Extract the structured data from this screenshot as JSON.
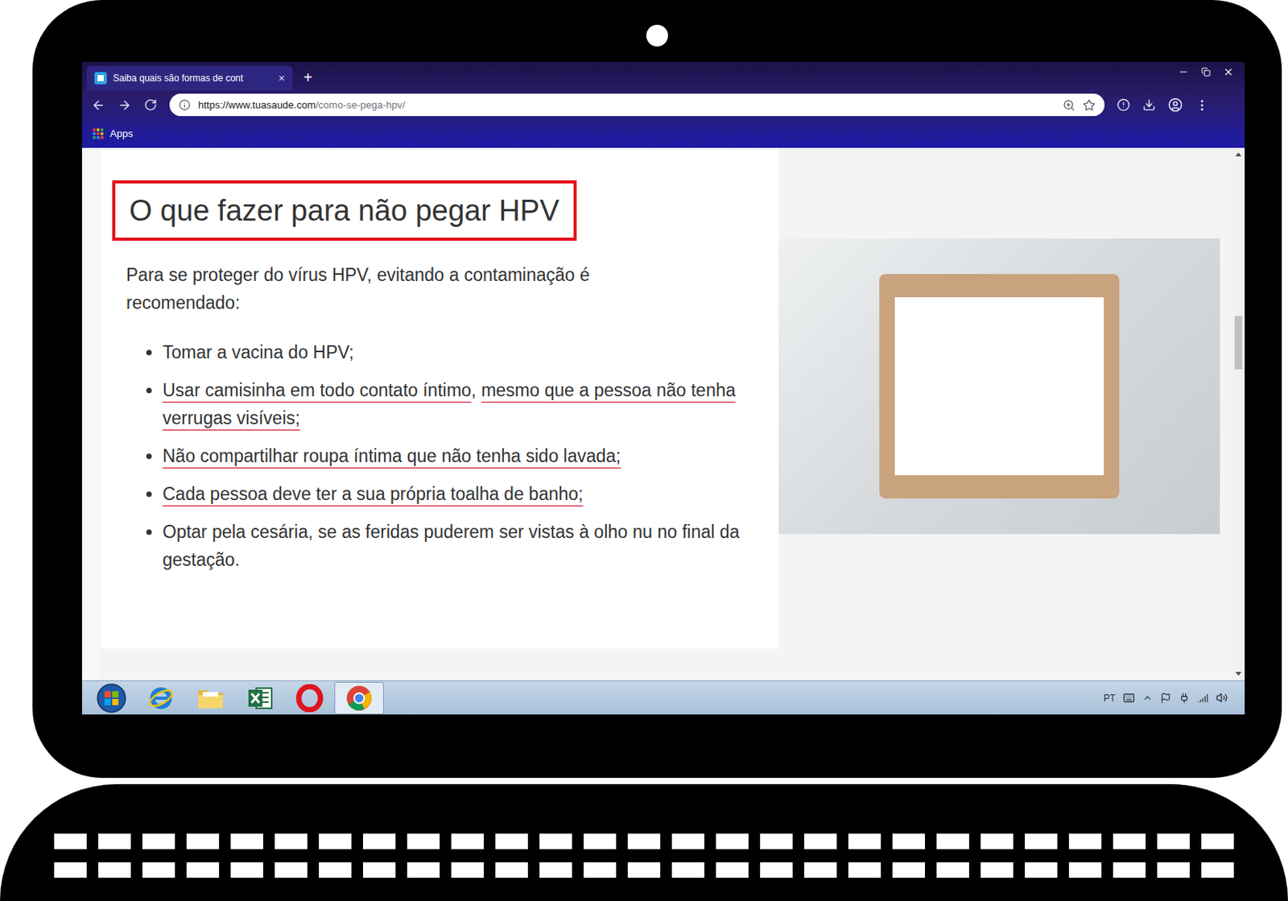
{
  "browser": {
    "tabs": [
      {
        "title": "Saiba quais são formas de cont",
        "close": "×",
        "selected": true
      }
    ],
    "new_tab": "+",
    "address": {
      "host": "https://www.tuasaude.com",
      "path": "/como-se-pega-hpv/"
    },
    "bookmarks": [
      {
        "label": "Apps"
      }
    ]
  },
  "page": {
    "heading": {
      "text": "O que fazer para não pegar HPV",
      "highlighted": true
    },
    "intro": "Para se proteger do vírus HPV, evitando a contaminação é recomendado:",
    "list": [
      {
        "segments": [
          {
            "text": "Tomar a vacina do HPV;",
            "underlined": false
          }
        ]
      },
      {
        "segments": [
          {
            "text": "Usar camisinha em todo contato íntimo",
            "underlined": true
          },
          {
            "text": ", ",
            "underlined": false
          },
          {
            "text": "mesmo que a pessoa não tenha verrugas visíveis;",
            "underlined": true
          }
        ]
      },
      {
        "segments": [
          {
            "text": "Não compartilhar roupa íntima que não tenha sido lavada;",
            "underlined": true
          }
        ]
      },
      {
        "segments": [
          {
            "text": "Cada pessoa deve ter a sua própria toalha de banho;",
            "underlined": true
          }
        ]
      },
      {
        "segments": [
          {
            "text": "Optar pela cesária, se as feridas puderem ser vistas à olho nu no final da gestação.",
            "underlined": false
          }
        ]
      }
    ]
  },
  "taskbar": {
    "apps": [
      {
        "kind": "start",
        "selected": false
      },
      {
        "kind": "ie",
        "selected": false
      },
      {
        "kind": "folder",
        "selected": false
      },
      {
        "kind": "excel",
        "selected": false
      },
      {
        "kind": "opera",
        "selected": false
      },
      {
        "kind": "chrome",
        "selected": true
      }
    ],
    "language": "PT"
  }
}
